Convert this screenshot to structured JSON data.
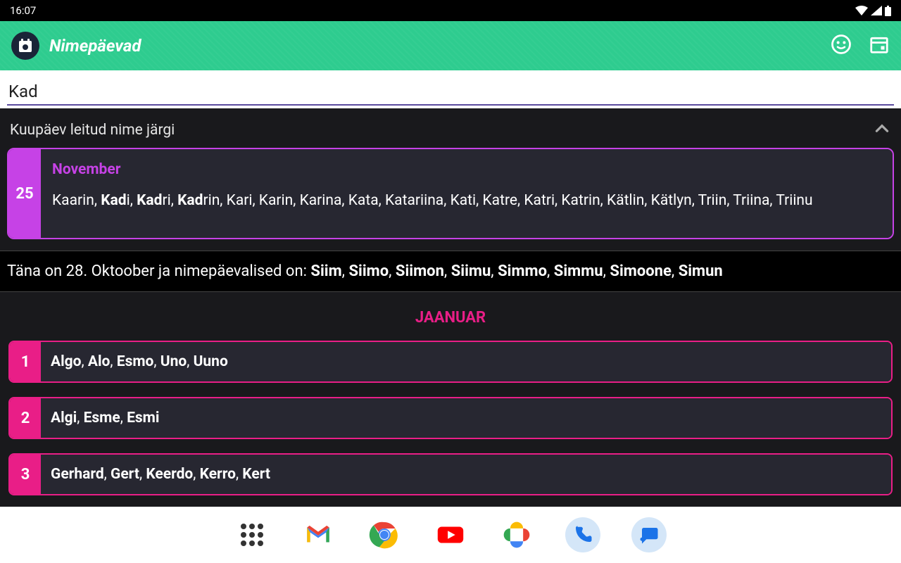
{
  "status": {
    "time": "16:07"
  },
  "appbar": {
    "title": "Nimepäevad"
  },
  "search": {
    "value": "Kad"
  },
  "found": {
    "label": "Kuupäev leitud nime järgi",
    "day": "25",
    "month": "November",
    "names_html": "Kaarin, <b>Kad</b>i, <b>Kad</b>ri, <b>Kad</b>rin, Kari, Karin, Karina, Kata, Katariina, Kati, Katre, Katri, Katrin, Kätlin, Kätlyn, Triin, Triina, Triinu"
  },
  "today": {
    "prefix": "Täna on 28. Oktoober ja nimepäevalised on: ",
    "names_html": "<b>Siim</b>, <b>Siimo</b>, <b>Siimon</b>, <b>Siimu</b>, <b>Simmo</b>, <b>Simmu</b>, <b>Simoone</b>, <b>Simun</b>"
  },
  "month": {
    "label": "JAANUAR"
  },
  "days": [
    {
      "num": "1",
      "names_html": "<b>Algo</b>, <b>Alo</b>, <b>Esmo</b>, <b>Uno</b>, <b>Uuno</b>"
    },
    {
      "num": "2",
      "names_html": "<b>Algi</b>, <b>Esme</b>, <b>Esmi</b>"
    },
    {
      "num": "3",
      "names_html": "<b>Gerhard</b>, <b>Gert</b>, <b>Keerdo</b>, <b>Kerro</b>, <b>Kert</b>"
    }
  ]
}
